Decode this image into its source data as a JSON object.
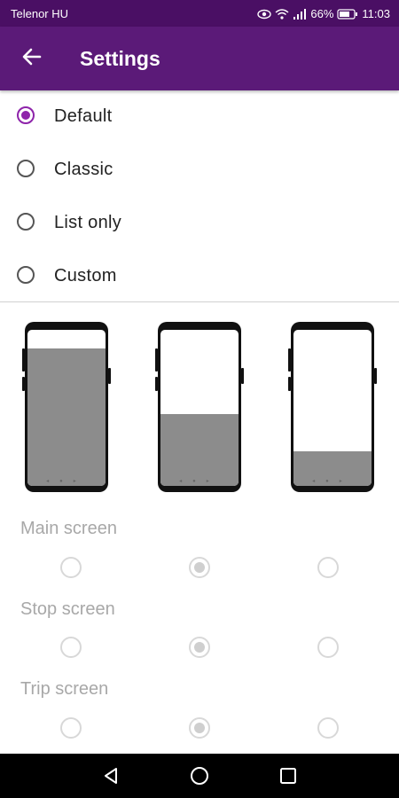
{
  "status_bar": {
    "carrier": "Telenor HU",
    "battery": "66%",
    "time": "11:03"
  },
  "app_bar": {
    "title": "Settings"
  },
  "layout_options": [
    {
      "label": "Default",
      "selected": true
    },
    {
      "label": "Classic",
      "selected": false
    },
    {
      "label": "List only",
      "selected": false
    },
    {
      "label": "Custom",
      "selected": false
    }
  ],
  "previews": [
    {
      "fill_fraction": 0.88
    },
    {
      "fill_fraction": 0.46
    },
    {
      "fill_fraction": 0.22
    }
  ],
  "sections": [
    {
      "label": "Main screen",
      "selected_index": 1
    },
    {
      "label": "Stop screen",
      "selected_index": 1
    },
    {
      "label": "Trip screen",
      "selected_index": 1
    }
  ],
  "icons": {
    "back": "arrow-left-icon",
    "status": [
      "eye-icon",
      "wifi-icon",
      "signal-icon",
      "battery-icon"
    ],
    "nav": [
      "back-triangle-icon",
      "home-circle-icon",
      "recents-square-icon"
    ]
  },
  "colors": {
    "status_bar": "#4a0f64",
    "app_bar": "#5b1a78",
    "accent": "#8e24aa"
  }
}
